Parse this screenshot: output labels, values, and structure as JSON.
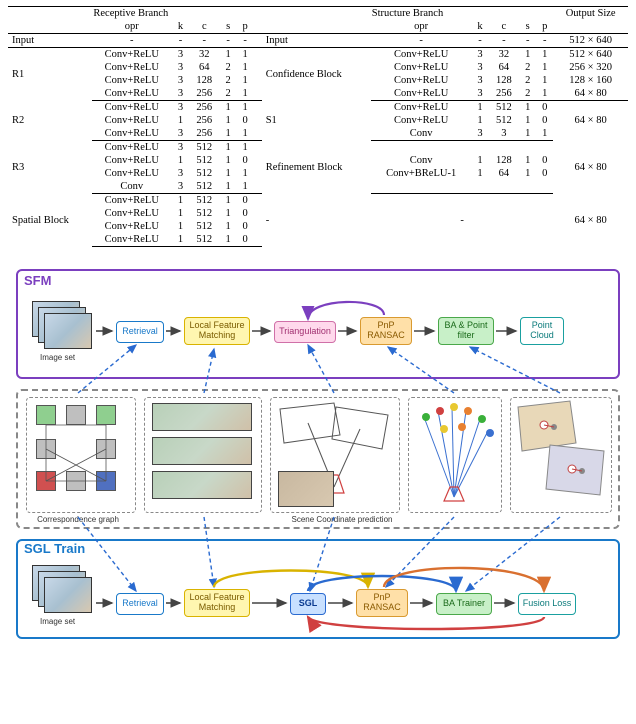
{
  "table": {
    "header": {
      "receptive": "Receptive Branch",
      "structure": "Structure Branch",
      "output": "Output Size",
      "cols": [
        "opr",
        "k",
        "c",
        "s",
        "p"
      ]
    },
    "rows": [
      {
        "group": "Input",
        "r": [
          [
            "-",
            "-",
            "-",
            "-",
            "-"
          ]
        ],
        "s_group": "Input",
        "s": [
          [
            "-",
            "-",
            "-",
            "-",
            "-"
          ]
        ],
        "out": "512 × 640"
      },
      {
        "group": "R1",
        "r": [
          [
            "Conv+ReLU",
            "3",
            "32",
            "1",
            "1"
          ],
          [
            "Conv+ReLU",
            "3",
            "64",
            "2",
            "1"
          ],
          [
            "Conv+ReLU",
            "3",
            "128",
            "2",
            "1"
          ],
          [
            "Conv+ReLU",
            "3",
            "256",
            "2",
            "1"
          ]
        ],
        "s_group": "Confidence Block",
        "s": [
          [
            "Conv+ReLU",
            "3",
            "32",
            "1",
            "1"
          ],
          [
            "Conv+ReLU",
            "3",
            "64",
            "2",
            "1"
          ],
          [
            "Conv+ReLU",
            "3",
            "128",
            "2",
            "1"
          ],
          [
            "Conv+ReLU",
            "3",
            "256",
            "2",
            "1"
          ]
        ],
        "out": [
          "512 × 640",
          "256 × 320",
          "128 × 160",
          "64 × 80"
        ]
      },
      {
        "group": "R2",
        "r": [
          [
            "Conv+ReLU",
            "3",
            "256",
            "1",
            "1"
          ],
          [
            "Conv+ReLU",
            "1",
            "256",
            "1",
            "0"
          ],
          [
            "Conv+ReLU",
            "3",
            "256",
            "1",
            "1"
          ]
        ],
        "s_group": "S1",
        "s": [
          [
            "Conv+ReLU",
            "1",
            "512",
            "1",
            "0"
          ],
          [
            "Conv+ReLU",
            "1",
            "512",
            "1",
            "0"
          ],
          [
            "Conv",
            "3",
            "3",
            "1",
            "1"
          ]
        ],
        "out": "64 × 80"
      },
      {
        "group": "R3",
        "r": [
          [
            "Conv+ReLU",
            "3",
            "512",
            "1",
            "1"
          ],
          [
            "Conv+ReLU",
            "1",
            "512",
            "1",
            "0"
          ],
          [
            "Conv+ReLU",
            "3",
            "512",
            "1",
            "1"
          ],
          [
            "Conv",
            "3",
            "512",
            "1",
            "1"
          ]
        ],
        "s_group": "Refinement Block",
        "s": [
          [
            "",
            "",
            "",
            "",
            ""
          ],
          [
            "Conv",
            "1",
            "128",
            "1",
            "0"
          ],
          [
            "Conv+BReLU-1",
            "1",
            "64",
            "1",
            "0"
          ],
          [
            "",
            "",
            "",
            "",
            ""
          ]
        ],
        "out": "64 × 80"
      },
      {
        "group": "Spatial Block",
        "r": [
          [
            "Conv+ReLU",
            "1",
            "512",
            "1",
            "0"
          ],
          [
            "Conv+ReLU",
            "1",
            "512",
            "1",
            "0"
          ],
          [
            "Conv+ReLU",
            "1",
            "512",
            "1",
            "0"
          ],
          [
            "Conv+ReLU",
            "1",
            "512",
            "1",
            "0"
          ]
        ],
        "s_group": "-",
        "s": [
          [
            "-",
            "-",
            "-",
            "-",
            "-"
          ]
        ],
        "out": "64 × 80"
      }
    ]
  },
  "diagram": {
    "sfm_title": "SFM",
    "sgl_title": "SGL Train",
    "imageset_label": "Image set",
    "boxes": {
      "retrieval": "Retrieval",
      "lfm": "Local Feature Matching",
      "triangulation": "Triangulation",
      "pnp": "PnP RANSAC",
      "ba_filter": "BA & Point filter",
      "pointcloud": "Point Cloud",
      "sgl": "SGL",
      "ba_trainer": "BA Trainer",
      "fusion": "Fusion Loss"
    },
    "mid_labels": {
      "corr": "Correspondence graph",
      "scene": "Scene Coordinate prediction"
    }
  }
}
